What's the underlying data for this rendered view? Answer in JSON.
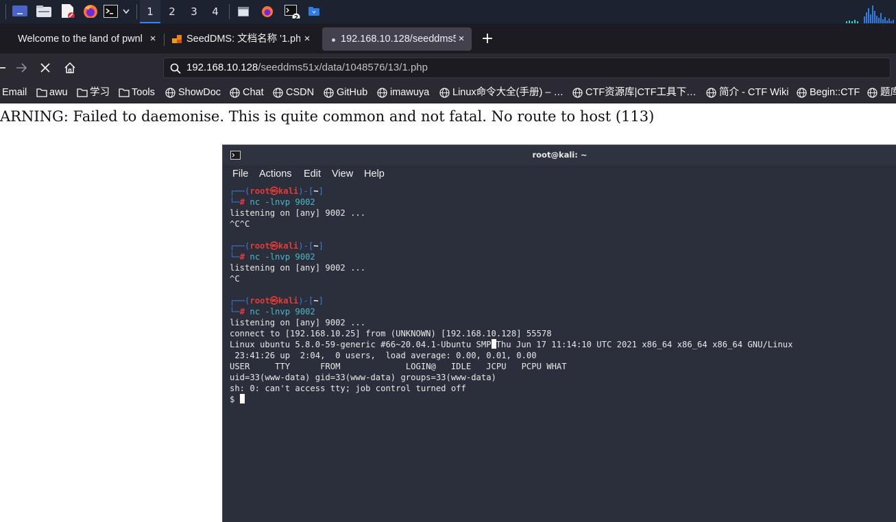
{
  "panel": {
    "workspaces": [
      "1",
      "2",
      "3",
      "4"
    ],
    "active_workspace": "1",
    "terminal_badge": "2",
    "icons": [
      "desktop-icon",
      "files-icon",
      "text-editor-icon",
      "firefox-icon",
      "terminal-icon",
      "chevron-down-icon",
      "window-icon",
      "firefox-icon",
      "terminal-icon",
      "folder-icon",
      "cpu-graph-icon"
    ]
  },
  "tabs": [
    {
      "title": "Welcome to the land of pwnl",
      "close": "×"
    },
    {
      "title": "SeedDMS: 文档名称 '1.php",
      "close": "×"
    },
    {
      "title": "192.168.10.128/seeddms5",
      "close": "×"
    }
  ],
  "new_tab_label": "+",
  "nav": {
    "url_host": "192.168.10.128",
    "url_path": "/seeddms51x/data/1048576/13/1.php"
  },
  "bookmarks": [
    {
      "label": "Email",
      "icon": "none"
    },
    {
      "label": "awu",
      "icon": "folder-icon"
    },
    {
      "label": "学习",
      "icon": "folder-icon"
    },
    {
      "label": "Tools",
      "icon": "folder-icon"
    },
    {
      "label": "ShowDoc",
      "icon": "globe-icon"
    },
    {
      "label": "Chat",
      "icon": "globe-icon"
    },
    {
      "label": "CSDN",
      "icon": "globe-icon"
    },
    {
      "label": "GitHub",
      "icon": "globe-icon"
    },
    {
      "label": "imawuya",
      "icon": "globe-icon"
    },
    {
      "label": "Linux命令大全(手册) – …",
      "icon": "globe-icon"
    },
    {
      "label": "CTF资源库|CTF工具下…",
      "icon": "globe-icon"
    },
    {
      "label": "简介 - CTF Wiki",
      "icon": "globe-icon"
    },
    {
      "label": "Begin::CTF",
      "icon": "globe-icon"
    },
    {
      "label": "题库",
      "icon": "globe-icon"
    }
  ],
  "page": {
    "warning": "ARNING: Failed to daemonise. This is quite common and not fatal. No route to host (113)"
  },
  "terminal": {
    "title": "root@kali: ~",
    "menu": [
      "File",
      "Actions",
      "Edit",
      "View",
      "Help"
    ],
    "prompt": {
      "user": "root",
      "sym": "㉿",
      "host": "kali",
      "dir": "~"
    },
    "blocks": [
      {
        "command": "nc -lnvp 9002",
        "output": [
          "listening on [any] 9002 ...",
          "^C^C"
        ]
      },
      {
        "command": "nc -lnvp 9002",
        "output": [
          "listening on [any] 9002 ...",
          "^C"
        ]
      },
      {
        "command": "nc -lnvp 9002",
        "output": [
          "listening on [any] 9002 ...",
          "connect to [192.168.10.25] from (UNKNOWN) [192.168.10.128] 55578",
          "Linux ubuntu 5.8.0-59-generic #66~20.04.1-Ubuntu SMP",
          " 23:41:26 up  2:04,  0 users,  load average: 0.00, 0.01, 0.00",
          "USER     TTY      FROM             LOGIN@   IDLE   JCPU   PCPU WHAT",
          "uid=33(www-data) gid=33(www-data) groups=33(www-data)",
          "sh: 0: can't access tty; job control turned off"
        ]
      }
    ],
    "uname_tail": "Thu Jun 17 11:14:10 UTC 2021 x86_64 x86_64 x86_64 GNU/Linux",
    "shell_prompt": "$ "
  }
}
